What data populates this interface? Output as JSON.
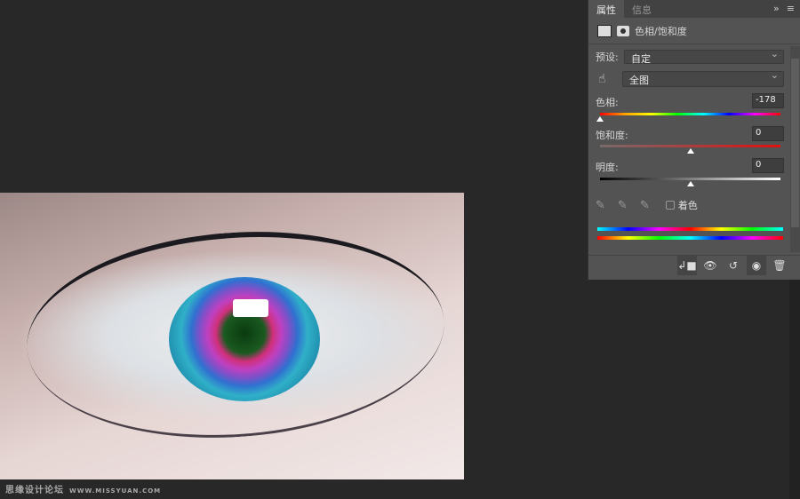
{
  "panel": {
    "tabs": [
      "属性",
      "信息"
    ],
    "title": "色相/饱和度",
    "preset_label": "预设:",
    "preset_value": "自定",
    "range_value": "全图",
    "hue_label": "色相:",
    "hue_value": "-178",
    "sat_label": "饱和度:",
    "sat_value": "0",
    "light_label": "明度:",
    "light_value": "0",
    "colorize_label": "着色",
    "colorize_checked": false,
    "hue_fraction": 0.0,
    "sat_fraction": 0.5,
    "light_fraction": 0.5
  },
  "watermark": {
    "cn": "思缘设计论坛",
    "url": "WWW.MISSYUAN.COM"
  }
}
